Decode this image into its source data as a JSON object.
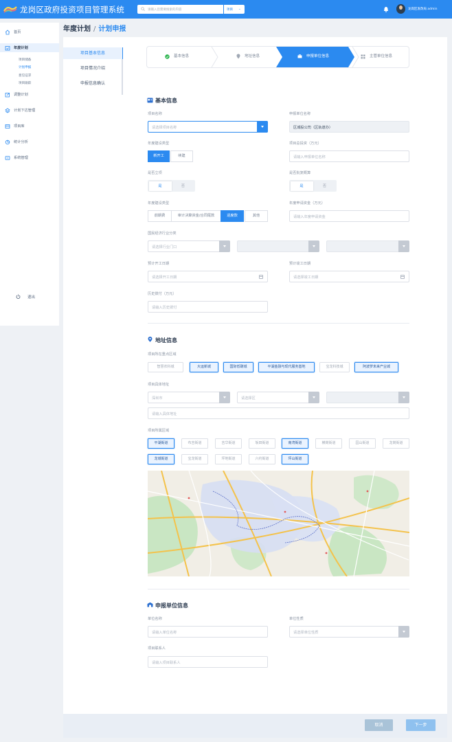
{
  "header": {
    "title": "龙岗区政府投资项目管理系统",
    "search_placeholder": "请输入您需要搜索的内容",
    "search_scope": "项目",
    "user": "龙岗区发改局 admin"
  },
  "sidebar": {
    "items": [
      {
        "label": "首页",
        "icon": "home-icon"
      },
      {
        "label": "年度计划",
        "icon": "calendar-icon"
      },
      {
        "label": "调整计划",
        "icon": "edit-icon"
      },
      {
        "label": "计划下达管理",
        "icon": "send-icon"
      },
      {
        "label": "项目库",
        "icon": "folder-icon"
      },
      {
        "label": "统计分析",
        "icon": "chart-icon"
      },
      {
        "label": "系统管理",
        "icon": "settings-icon"
      }
    ],
    "subitems": [
      "项目储备",
      "计划申报",
      "意见征求",
      "项目跟踪"
    ],
    "logout": "退出"
  },
  "breadcrumb": {
    "parent": "年度计划",
    "sep": "/",
    "current": "计划申报"
  },
  "left_nav": [
    "项目基本信息",
    "项目情况介绍",
    "申报信息确认"
  ],
  "steps": [
    "基本信息",
    "地址信息",
    "申报单位信息",
    "主管单位信息"
  ],
  "basic": {
    "title": "基本信息",
    "project_name_label": "项目名称",
    "project_name_ph": "请选择项目名称",
    "unit_label": "申报单位名称",
    "unit_value": "区城投公司（区轨道办）",
    "build_type_label": "年度建设类型",
    "build_type_opts": [
      "新开工",
      "续建"
    ],
    "total_invest_label": "项目总投资（万元）",
    "total_invest_ph": "请输入申报单位名称",
    "is_pushed_label": "是否立项",
    "is_pushed_opts": [
      "是",
      "否"
    ],
    "is_budget_label": "是否批复概算",
    "is_budget_opts": [
      "是",
      "否"
    ],
    "fund_type_label": "年度建设类型",
    "fund_type_opts": [
      "前期费",
      "审计决算资金/合同尾款",
      "进度款",
      "其他"
    ],
    "year_fund_label": "年度申请资金（万元）",
    "year_fund_ph": "请输入年度申请资金",
    "industry_label": "国民经济行业分类",
    "industry_ph": "请选择行业门口",
    "start_label": "预计开工日期",
    "start_ph": "请选择开工日期",
    "end_label": "预计竣工日期",
    "end_ph": "请选择竣工日期",
    "history_label": "历史拨付（万元）",
    "history_ph": "请输入历史拨付"
  },
  "address": {
    "title": "地址信息",
    "zone_label": "项目所在重点区域",
    "zones": [
      {
        "name": "智慧农科城",
        "on": false
      },
      {
        "name": "大运新城",
        "on": true
      },
      {
        "name": "国际低碳城",
        "on": true
      },
      {
        "name": "平湖金融与现代服务基地",
        "on": true
      },
      {
        "name": "宝龙科技城",
        "on": false
      },
      {
        "name": "阿波罗未来产业城",
        "on": true
      }
    ],
    "addr_label": "项目具体地址",
    "city": "深圳市",
    "district_ph": "请选择区",
    "detail_ph": "请输入具体地址",
    "street_label": "项目所属区域",
    "streets": [
      {
        "name": "平湖街道",
        "on": true
      },
      {
        "name": "布吉街道",
        "on": false
      },
      {
        "name": "吉华街道",
        "on": false
      },
      {
        "name": "坂田街道",
        "on": false
      },
      {
        "name": "南湾街道",
        "on": true
      },
      {
        "name": "横岗街道",
        "on": false
      },
      {
        "name": "园山街道",
        "on": false
      },
      {
        "name": "龙岗街道",
        "on": false
      },
      {
        "name": "龙城街道",
        "on": true
      },
      {
        "name": "宝龙街道",
        "on": false
      },
      {
        "name": "坪地街道",
        "on": false
      },
      {
        "name": "六约街道",
        "on": false
      },
      {
        "name": "坪山街道",
        "on": true
      }
    ]
  },
  "applicant": {
    "title": "申报单位信息",
    "unit_label": "单位名称",
    "unit_ph": "请输入单位名称",
    "nature_label": "单位性质",
    "nature_ph": "请选择单位性质",
    "contact_label": "项目联系人",
    "contact_ph": "请输入项目联系人"
  },
  "footer": {
    "cancel": "取消",
    "next": "下一步"
  },
  "colors": {
    "primary": "#2b8af0",
    "header": "#2b8af0",
    "bg": "#eef1f5"
  }
}
